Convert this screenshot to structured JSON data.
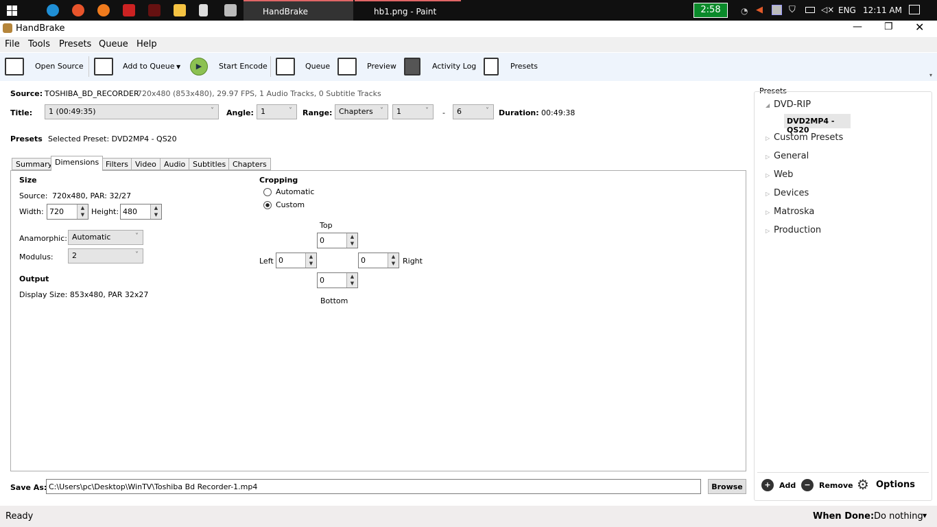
{
  "taskbar": {
    "tasks": [
      "HandBrake",
      "hb1.png - Paint"
    ],
    "battery_time": "2:58",
    "language": "ENG",
    "clock": "12:11 AM"
  },
  "window": {
    "title": "HandBrake"
  },
  "menu": [
    "File",
    "Tools",
    "Presets",
    "Queue",
    "Help"
  ],
  "toolbar": {
    "open_source": "Open Source",
    "add_to_queue": "Add to Queue",
    "start_encode": "Start Encode",
    "queue": "Queue",
    "preview": "Preview",
    "activity_log": "Activity Log",
    "presets": "Presets"
  },
  "source": {
    "label": "Source:",
    "name": "TOSHIBA_BD_RECORDER",
    "info": "720x480 (853x480), 29.97 FPS, 1 Audio Tracks, 0 Subtitle Tracks"
  },
  "title_row": {
    "title_label": "Title:",
    "title_value": "1 (00:49:35)",
    "angle_label": "Angle:",
    "angle_value": "1",
    "range_label": "Range:",
    "range_type": "Chapters",
    "range_start": "1",
    "dash": "-",
    "range_end": "6",
    "duration_label": "Duration:",
    "duration_value": "00:49:38"
  },
  "presets_row": {
    "label": "Presets",
    "selected": "Selected Preset:  DVD2MP4 - QS20"
  },
  "tabs": [
    "Summary",
    "Dimensions",
    "Filters",
    "Video",
    "Audio",
    "Subtitles",
    "Chapters"
  ],
  "dimensions": {
    "size_heading": "Size",
    "source_label": "Source:",
    "source_value": "720x480, PAR: 32/27",
    "width_label": "Width:",
    "width_value": "720",
    "height_label": "Height:",
    "height_value": "480",
    "anamorphic_label": "Anamorphic:",
    "anamorphic_value": "Automatic",
    "modulus_label": "Modulus:",
    "modulus_value": "2",
    "output_heading": "Output",
    "display_size": "Display Size: 853x480,  PAR 32x27"
  },
  "cropping": {
    "heading": "Cropping",
    "automatic": "Automatic",
    "custom": "Custom",
    "top_label": "Top",
    "top": "0",
    "left_label": "Left",
    "left": "0",
    "right_label": "Right",
    "right": "0",
    "bottom_label": "Bottom",
    "bottom": "0"
  },
  "save": {
    "label": "Save As:",
    "path": "C:\\Users\\pc\\Desktop\\WinTV\\Toshiba Bd Recorder-1.mp4",
    "browse": "Browse"
  },
  "presets_panel": {
    "title": "Presets",
    "items": [
      {
        "label": "DVD-RIP",
        "expanded": true
      },
      {
        "label": "Custom Presets"
      },
      {
        "label": "General"
      },
      {
        "label": "Web"
      },
      {
        "label": "Devices"
      },
      {
        "label": "Matroska"
      },
      {
        "label": "Production"
      }
    ],
    "selected_child": "DVD2MP4 - QS20",
    "add": "Add",
    "remove": "Remove",
    "options": "Options"
  },
  "status": {
    "text": "Ready",
    "when_done_label": "When Done:",
    "when_done_value": "Do nothing"
  }
}
